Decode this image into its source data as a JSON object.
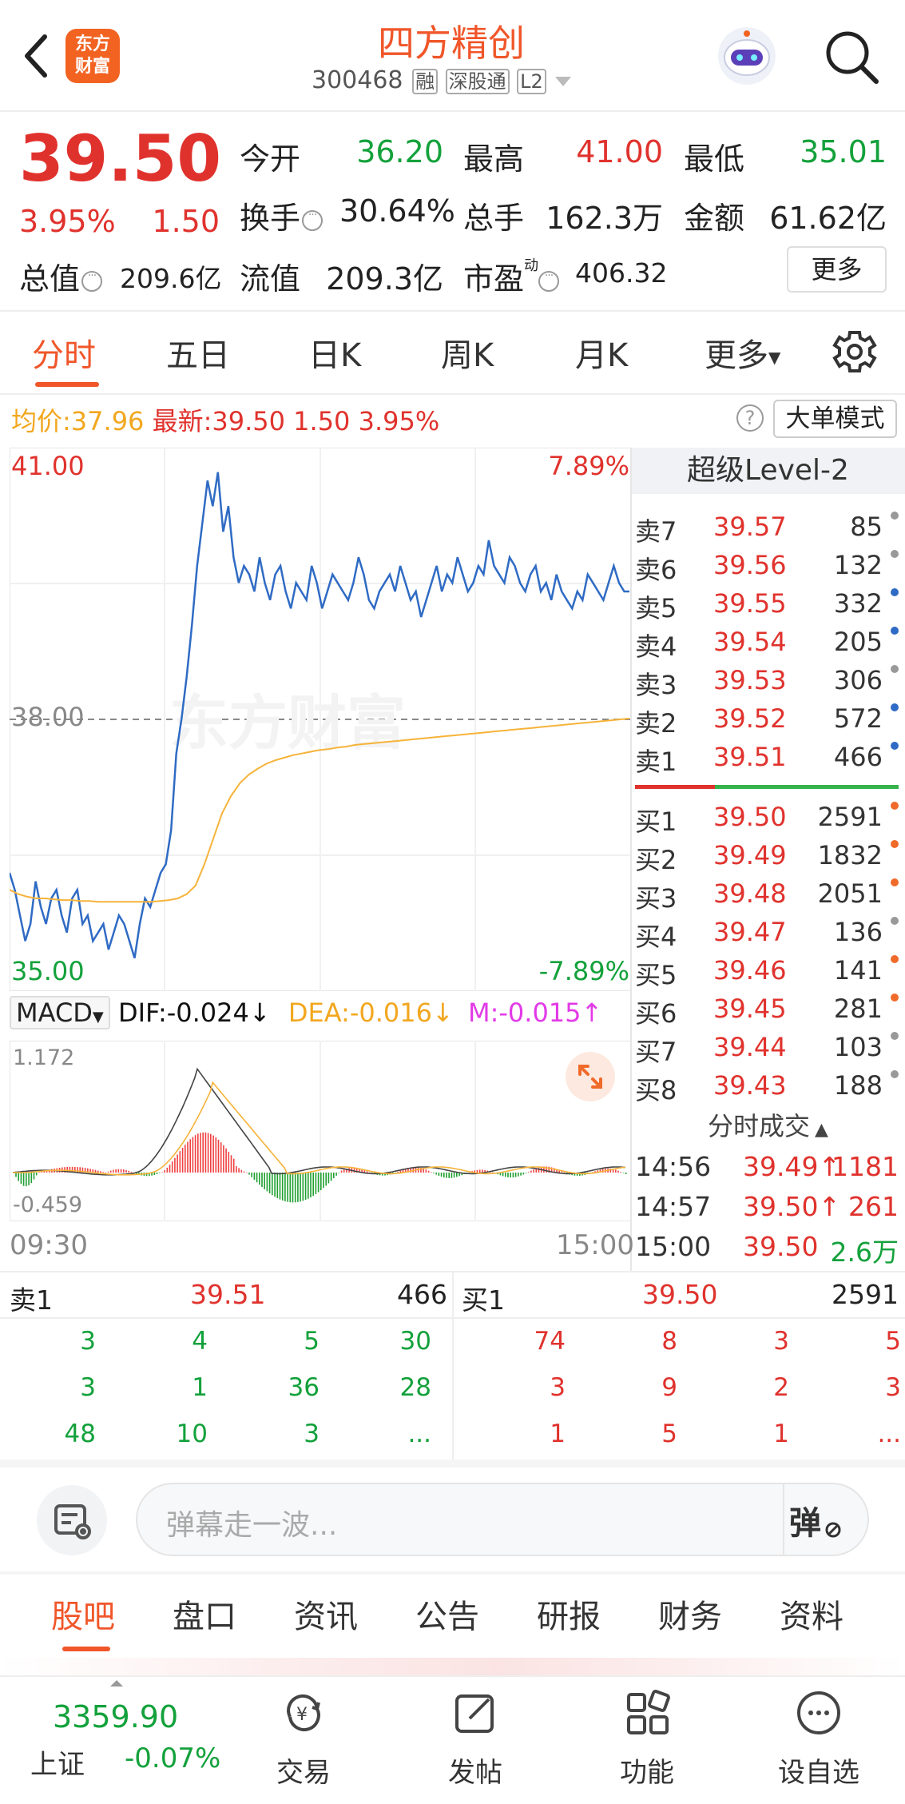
{
  "header": {
    "back": "<",
    "logo_line1": "东方",
    "logo_line2": "财富",
    "title": "四方精创",
    "code": "300468",
    "badges": [
      "融",
      "深股通",
      "L2"
    ]
  },
  "quote": {
    "price": "39.50",
    "pct": "3.95%",
    "change": "1.50",
    "open_label": "今开",
    "open": "36.20",
    "high_label": "最高",
    "high": "41.00",
    "low_label": "最低",
    "low": "35.01",
    "turnover_label": "换手",
    "turnover": "30.64%",
    "volume_label": "总手",
    "volume": "162.3万",
    "amount_label": "金额",
    "amount": "61.62亿",
    "mcap_label": "总值",
    "mcap": "209.6亿",
    "float_label": "流值",
    "float": "209.3亿",
    "pe_label": "市盈",
    "pe_sup": "动",
    "pe": "406.32",
    "more_label": "更多"
  },
  "tabs": [
    "分时",
    "五日",
    "日K",
    "周K",
    "月K",
    "更多"
  ],
  "info_bar": {
    "avg_label": "均价:",
    "avg": "37.96",
    "last_label": "最新:",
    "last": "39.50",
    "chg": "1.50",
    "pct": "3.95%",
    "mode": "大单模式"
  },
  "chart_data": [
    {
      "type": "line",
      "title": "",
      "x_range": [
        "09:30",
        "15:00"
      ],
      "ylim": [
        35.0,
        41.0
      ],
      "y_labels": {
        "top": "41.00",
        "mid": "38.00",
        "bottom": "35.00"
      },
      "pct_labels": {
        "top": "7.89%",
        "bottom": "-7.89%"
      },
      "watermark": "东方财富",
      "series": [
        {
          "name": "最新",
          "color": "#2f6bc4",
          "values": [
            36.2,
            36.0,
            35.7,
            35.4,
            35.6,
            36.1,
            35.8,
            35.6,
            35.9,
            36.0,
            35.7,
            35.5,
            35.9,
            36.0,
            35.6,
            35.7,
            35.4,
            35.5,
            35.6,
            35.3,
            35.5,
            35.7,
            35.6,
            35.4,
            35.2,
            35.6,
            35.9,
            35.8,
            36.0,
            36.2,
            36.3,
            36.7,
            37.6,
            38.0,
            38.5,
            39.1,
            39.8,
            40.3,
            40.8,
            40.5,
            40.9,
            40.2,
            40.5,
            39.9,
            39.6,
            39.8,
            39.7,
            39.5,
            39.9,
            39.6,
            39.4,
            39.7,
            39.8,
            39.5,
            39.3,
            39.6,
            39.5,
            39.4,
            39.8,
            39.6,
            39.3,
            39.5,
            39.7,
            39.6,
            39.5,
            39.4,
            39.6,
            39.9,
            39.7,
            39.4,
            39.3,
            39.5,
            39.6,
            39.7,
            39.5,
            39.8,
            39.6,
            39.4,
            39.5,
            39.2,
            39.4,
            39.6,
            39.8,
            39.5,
            39.7,
            39.6,
            39.9,
            39.7,
            39.5,
            39.6,
            39.8,
            39.7,
            40.1,
            39.8,
            39.7,
            39.6,
            39.9,
            39.8,
            39.6,
            39.5,
            39.7,
            39.8,
            39.5,
            39.6,
            39.4,
            39.7,
            39.5,
            39.4,
            39.3,
            39.5,
            39.4,
            39.7,
            39.6,
            39.5,
            39.4,
            39.6,
            39.8,
            39.6,
            39.5,
            39.5
          ]
        },
        {
          "name": "均价",
          "color": "#f6b33a",
          "values": [
            36.0,
            35.95,
            35.92,
            35.9,
            35.9,
            35.89,
            35.88,
            35.88,
            35.87,
            35.87,
            35.86,
            35.86,
            35.86,
            35.86,
            35.86,
            35.86,
            35.86,
            35.87,
            35.88,
            35.9,
            35.95,
            36.05,
            36.3,
            36.6,
            36.9,
            37.1,
            37.25,
            37.35,
            37.42,
            37.48,
            37.52,
            37.55,
            37.58,
            37.6,
            37.62,
            37.64,
            37.65,
            37.67,
            37.68,
            37.7,
            37.71,
            37.72,
            37.73,
            37.74,
            37.75,
            37.76,
            37.77,
            37.78,
            37.79,
            37.8,
            37.81,
            37.82,
            37.83,
            37.84,
            37.85,
            37.86,
            37.87,
            37.88,
            37.89,
            37.9,
            37.91,
            37.92,
            37.93,
            37.94,
            37.95,
            37.96,
            37.97,
            37.98,
            37.99,
            38.0,
            38.01
          ]
        }
      ]
    },
    {
      "type": "bar",
      "title": "MACD",
      "indicator_label": "MACD",
      "dif_label": "DIF:-0.024",
      "dea_label": "DEA:-0.016",
      "m_label": "M:-0.015",
      "ylim": [
        -0.459,
        1.172
      ],
      "y_labels": {
        "top": "1.172",
        "bottom": "-0.459"
      },
      "x_labels": [
        "09:30",
        "15:00"
      ]
    }
  ],
  "orderbook": {
    "title": "超级Level-2",
    "asks": [
      {
        "label": "卖7",
        "price": "39.57",
        "vol": "85",
        "dot": "#999"
      },
      {
        "label": "卖6",
        "price": "39.56",
        "vol": "132",
        "dot": "#999"
      },
      {
        "label": "卖5",
        "price": "39.55",
        "vol": "332",
        "dot": "#2f6bc4"
      },
      {
        "label": "卖4",
        "price": "39.54",
        "vol": "205",
        "dot": "#2f6bc4"
      },
      {
        "label": "卖3",
        "price": "39.53",
        "vol": "306",
        "dot": "#999"
      },
      {
        "label": "卖2",
        "price": "39.52",
        "vol": "572",
        "dot": "#2f6bc4"
      },
      {
        "label": "卖1",
        "price": "39.51",
        "vol": "466",
        "dot": "#2f6bc4"
      }
    ],
    "bids": [
      {
        "label": "买1",
        "price": "39.50",
        "vol": "2591",
        "dot": "#f06a2a"
      },
      {
        "label": "买2",
        "price": "39.49",
        "vol": "1832",
        "dot": "#f06a2a"
      },
      {
        "label": "买3",
        "price": "39.48",
        "vol": "2051",
        "dot": "#f06a2a"
      },
      {
        "label": "买4",
        "price": "39.47",
        "vol": "136",
        "dot": "#999"
      },
      {
        "label": "买5",
        "price": "39.46",
        "vol": "141",
        "dot": "#f06a2a"
      },
      {
        "label": "买6",
        "price": "39.45",
        "vol": "281",
        "dot": "#f06a2a"
      },
      {
        "label": "买7",
        "price": "39.44",
        "vol": "103",
        "dot": "#999"
      },
      {
        "label": "买8",
        "price": "39.43",
        "vol": "188",
        "dot": "#999"
      }
    ],
    "ticks_title": "分时成交",
    "ticks": [
      {
        "time": "14:56",
        "price": "39.49↑",
        "vol": "1181"
      },
      {
        "time": "14:57",
        "price": "39.50↑",
        "vol": "261"
      },
      {
        "time": "15:00",
        "price": "39.50",
        "vol": "2.6万"
      }
    ]
  },
  "depth": {
    "sell_label": "卖1",
    "sell_price": "39.51",
    "sell_vol": "466",
    "buy_label": "买1",
    "buy_price": "39.50",
    "buy_vol": "2591",
    "sell_rows": [
      [
        "3",
        "4",
        "5",
        "30"
      ],
      [
        "3",
        "1",
        "36",
        "28"
      ],
      [
        "48",
        "10",
        "3",
        "..."
      ]
    ],
    "buy_rows": [
      [
        "74",
        "8",
        "3",
        "5"
      ],
      [
        "3",
        "9",
        "2",
        "3"
      ],
      [
        "1",
        "5",
        "1",
        "..."
      ]
    ]
  },
  "danmu": {
    "placeholder": "弹幕走一波...",
    "send": "弹"
  },
  "bottom_tabs": [
    "股吧",
    "盘口",
    "资讯",
    "公告",
    "研报",
    "财务",
    "资料"
  ],
  "footer": {
    "index_value": "3359.90",
    "index_name": "上证",
    "index_pct": "-0.07%",
    "items": [
      "交易",
      "发帖",
      "功能",
      "设自选"
    ]
  }
}
